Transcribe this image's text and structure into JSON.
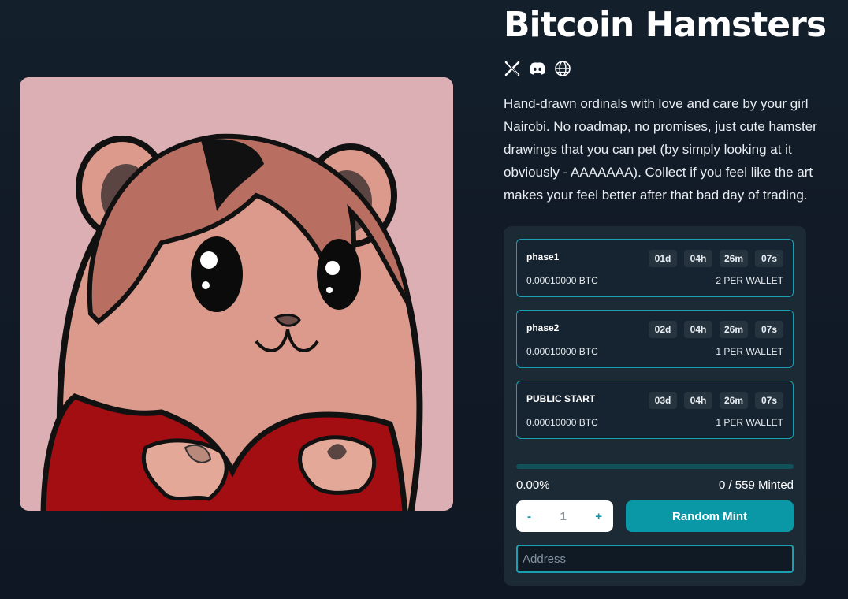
{
  "collection": {
    "title": "Bitcoin Hamsters",
    "description": "Hand-drawn ordinals with love and care by your girl Nairobi. No roadmap, no promises, just cute hamster drawings that you can pet (by simply looking at it obviously - AAAAAAA). Collect if you feel like the art makes your feel better after that bad day of trading.",
    "socials": [
      "x-icon",
      "discord-icon",
      "globe-icon"
    ]
  },
  "phases": [
    {
      "name": "phase1",
      "price": "0.00010000 BTC",
      "limit": "2 PER WALLET",
      "timer": [
        "01d",
        "04h",
        "26m",
        "07s"
      ]
    },
    {
      "name": "phase2",
      "price": "0.00010000 BTC",
      "limit": "1 PER WALLET",
      "timer": [
        "02d",
        "04h",
        "26m",
        "07s"
      ]
    },
    {
      "name": "PUBLIC START",
      "price": "0.00010000 BTC",
      "limit": "1 PER WALLET",
      "timer": [
        "03d",
        "04h",
        "26m",
        "07s"
      ]
    }
  ],
  "progress": {
    "percent_label": "0.00%",
    "minted_label": "0 / 559 Minted",
    "fraction": 0
  },
  "mint": {
    "decrement_label": "-",
    "quantity": "1",
    "increment_label": "+",
    "button_label": "Random Mint",
    "address_placeholder": "Address"
  },
  "colors": {
    "accent": "#0a98a6",
    "border": "#1aa0b0",
    "panel": "#1c2a35",
    "art_background": "#dbafb3"
  }
}
